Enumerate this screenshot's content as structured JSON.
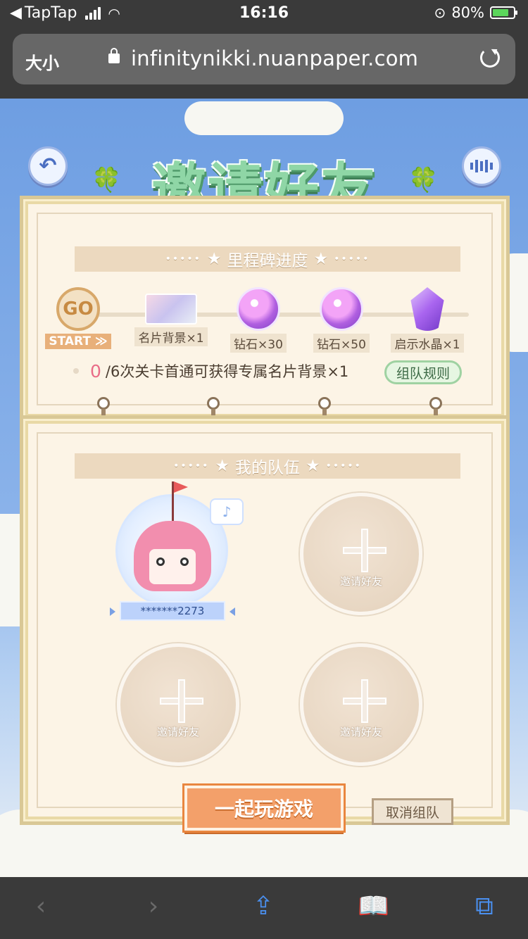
{
  "status_bar": {
    "back_app": "TapTap",
    "time": "16:16",
    "battery_percent": "80%",
    "battery_level": 0.8
  },
  "browser": {
    "text_size_label": "大小",
    "url": "infinitynikki.nuanpaper.com"
  },
  "page": {
    "title": "邀请好友",
    "milestone_header": "里程碑进度",
    "milestones": [
      {
        "icon": "go-badge-icon",
        "badge": "GO",
        "label": "START ≫"
      },
      {
        "icon": "card-background-icon",
        "label": "名片背景×1"
      },
      {
        "icon": "diamond-icon",
        "label": "钻石×30"
      },
      {
        "icon": "diamond-icon",
        "label": "钻石×50"
      },
      {
        "icon": "crystal-icon",
        "label": "启示水晶×1"
      }
    ],
    "progress_count": "0",
    "progress_text": "/6次关卡首通可获得专属名片背景×1",
    "rules_button": "组队规则",
    "team_header": "我的队伍",
    "member_name": "*******2273",
    "invite_label": "邀请好友",
    "play_button": "一起玩游戏",
    "cancel_button": "取消组队"
  },
  "colors": {
    "sky": "#6e9ee2",
    "title_green": "#8fd6a6",
    "play_orange": "#f3a06a",
    "progress_pink": "#e96c87",
    "safari_blue": "#4a90f0"
  }
}
